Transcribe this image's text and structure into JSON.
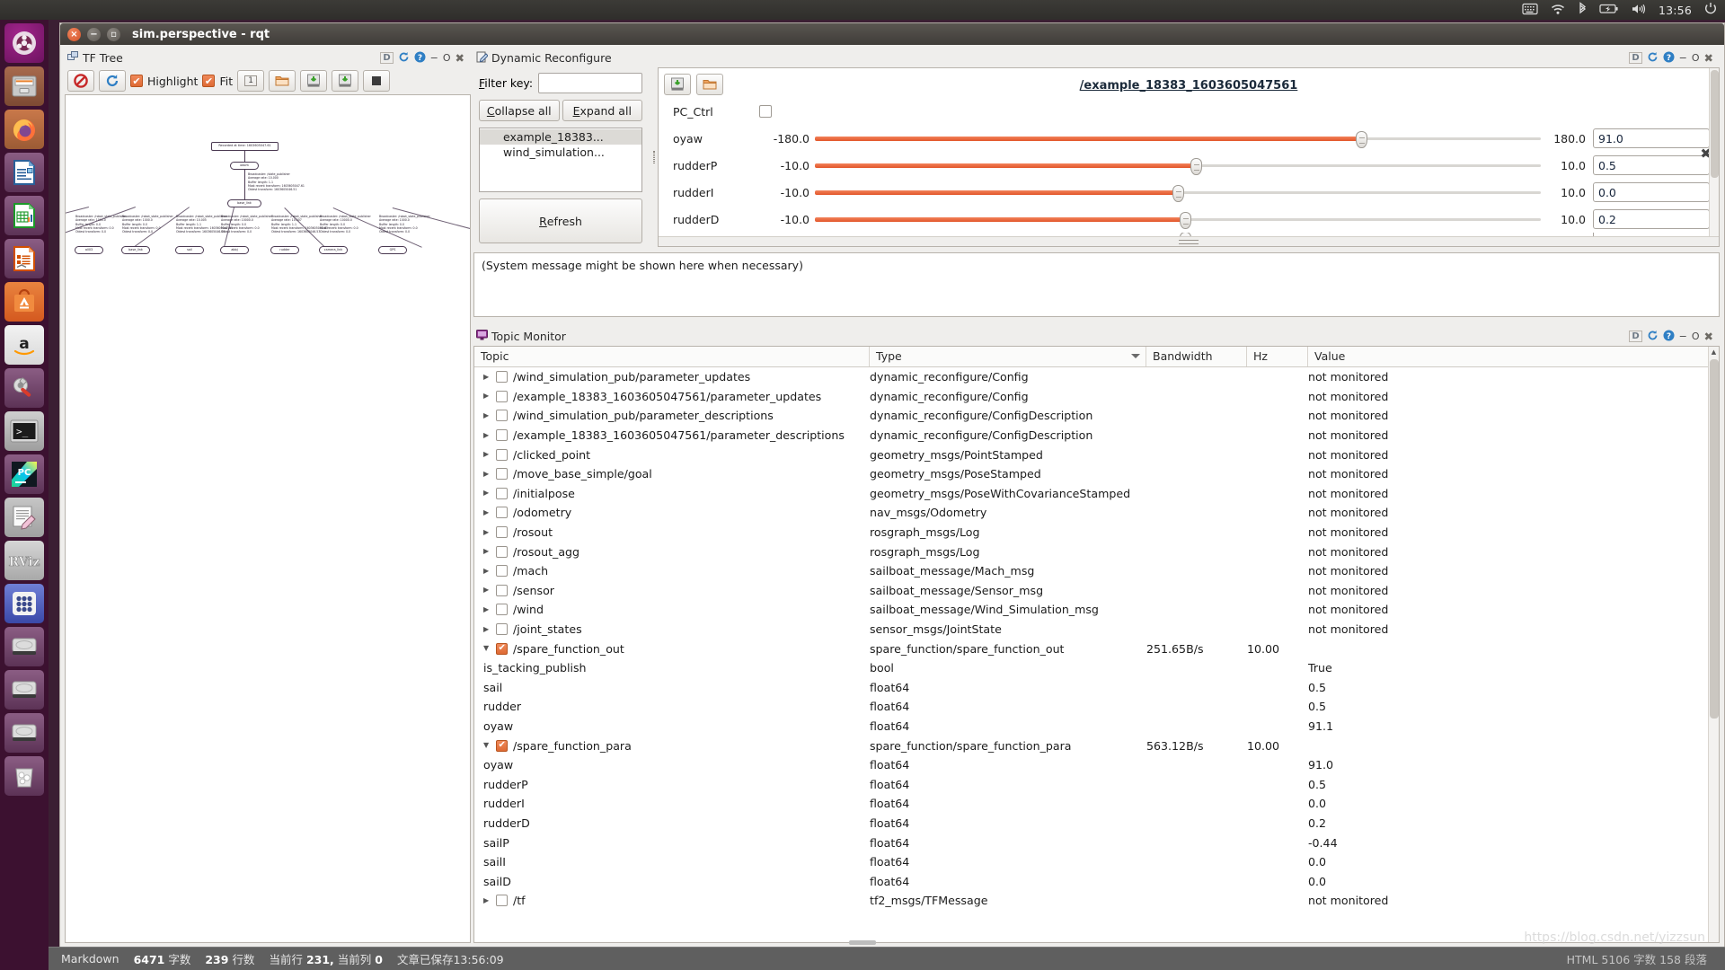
{
  "top_panel": {
    "icons": [
      "keyboard-icon",
      "wifi-icon",
      "bluetooth-icon",
      "battery-icon",
      "volume-icon",
      "power-icon"
    ],
    "clock": "13:56"
  },
  "launcher": {
    "items": [
      {
        "name": "ubuntu-dash-icon",
        "label": "Dash"
      },
      {
        "name": "files-icon",
        "label": "Files"
      },
      {
        "name": "firefox-icon",
        "label": "Firefox"
      },
      {
        "name": "libreoffice-writer-icon",
        "label": "LibreOffice Writer"
      },
      {
        "name": "libreoffice-calc-icon",
        "label": "LibreOffice Calc"
      },
      {
        "name": "libreoffice-impress-icon",
        "label": "LibreOffice Impress"
      },
      {
        "name": "ubuntu-software-icon",
        "label": "Ubuntu Software"
      },
      {
        "name": "amazon-icon",
        "label": "Amazon"
      },
      {
        "name": "system-settings-icon",
        "label": "System Settings"
      },
      {
        "name": "terminal-icon",
        "label": "Terminal"
      },
      {
        "name": "pycharm-icon",
        "label": "PyCharm"
      },
      {
        "name": "text-editor-icon",
        "label": "Text Editor"
      },
      {
        "name": "rviz-icon",
        "label": "RViz"
      },
      {
        "name": "show-applications-icon",
        "label": "Show Applications"
      },
      {
        "name": "disk-icon-1",
        "label": "Volume"
      },
      {
        "name": "disk-icon-2",
        "label": "Volume"
      },
      {
        "name": "disk-icon-3",
        "label": "Volume"
      },
      {
        "name": "trash-icon",
        "label": "Trash"
      }
    ]
  },
  "window": {
    "title": "sim.perspective - rqt"
  },
  "tf_tree": {
    "title": "TF Tree",
    "toolbar": {
      "stop_icon": "stop-refresh-icon",
      "refresh_icon": "refresh-icon",
      "highlight_label": "Highlight",
      "highlight_checked": true,
      "fit_label": "Fit",
      "fit_checked": true,
      "counter_label": "1",
      "open_icon": "open-folder-icon",
      "save_dot_icon": "save-dot-icon",
      "save_image_icon": "save-image-icon",
      "fullscreen_icon": "fullscreen-icon"
    },
    "dock_controls": [
      "D",
      "refresh-icon",
      "help-icon",
      "-",
      "O",
      "x"
    ],
    "graph": {
      "root_label": "Recorded at time: 1603605047.61",
      "nodes": [
        {
          "id": "odom",
          "label": "odom"
        },
        {
          "id": "base_link",
          "label": "base_link"
        },
        {
          "id": "all03",
          "label": "all03"
        },
        {
          "id": "base_link2",
          "label": "base_link"
        },
        {
          "id": "sail",
          "label": "sail"
        },
        {
          "id": "abbj",
          "label": "abbj"
        },
        {
          "id": "rudder",
          "label": "rudder"
        },
        {
          "id": "camera_link",
          "label": "camera_link"
        },
        {
          "id": "gps",
          "label": "GPS"
        }
      ],
      "edge_info": [
        "Broadcaster: /state_publisher\nAverage rate: 10.000\nBuffer length: 1.1\nMost recent transform: 1603605047.61\nOldest transform: 1603605046.51",
        "Broadcaster: /robot_state_publisher\nAverage rate: 1000.0\nBuffer length: 0.0\nMost recent transform: 0.0\nOldest transform: 0.0",
        "Broadcaster: /robot_state_publisher\nAverage rate: 1000.0\nBuffer length: 0.0\nMost recent transform: 0.0\nOldest transform: 0.0",
        "Broadcaster: /robot_state_publisher\nAverage rate: 10.005\nBuffer length: 1.1\nMost recent transform: 1603605047.63\nOldest transform: 1603605046.53",
        "Broadcaster: /robot_state_publisher\nAverage rate: 10000.0\nBuffer length: 0.0\nMost recent transform: 0.0\nOldest transform: 0.0",
        "Broadcaster: /robot_state_publisher\nAverage rate: 10.007\nBuffer length: 1.1\nMost recent transform: 1603605047.63\nOldest transform: 1603605046.53",
        "Broadcaster: /robot_state_publisher\nAverage rate: 10000.0\nBuffer length: 0.0\nMost recent transform: 0.0\nOldest transform: 0.0",
        "Broadcaster: /robot_state_publisher\nAverage rate: 1000.0\nBuffer length: 0.0\nMost recent transform: 0.0\nOldest transform: 0.0"
      ]
    }
  },
  "dynamic_reconfigure": {
    "title": "Dynamic Reconfigure",
    "filter_label": "Filter key:",
    "filter_value": "",
    "filter_placeholder": "",
    "collapse_all_label": "Collapse all",
    "expand_all_label": "Expand all",
    "refresh_label": "Refresh",
    "nodes": [
      {
        "label": "example_18383...",
        "selected": true
      },
      {
        "label": "wind_simulation...",
        "selected": false
      }
    ],
    "dock_controls": [
      "D",
      "refresh-icon",
      "help-icon",
      "-",
      "O",
      "x"
    ],
    "selected_node_title": "/example_18383_1603605047561",
    "toolbar": {
      "save_icon": "save-config-icon",
      "load_icon": "load-config-icon"
    },
    "close_label": "✖",
    "params": [
      {
        "name": "PC_Ctrl",
        "type": "bool",
        "checked": false
      },
      {
        "name": "oyaw",
        "type": "double",
        "min": "-180.0",
        "max": "180.0",
        "value": "91.0",
        "pct": 75.3
      },
      {
        "name": "rudderP",
        "type": "double",
        "min": "-10.0",
        "max": "10.0",
        "value": "0.5",
        "pct": 52.5
      },
      {
        "name": "rudderI",
        "type": "double",
        "min": "-10.0",
        "max": "10.0",
        "value": "0.0",
        "pct": 50.0
      },
      {
        "name": "rudderD",
        "type": "double",
        "min": "-10.0",
        "max": "10.0",
        "value": "0.2",
        "pct": 51.0
      }
    ]
  },
  "system_message": "(System message might be shown here when necessary)",
  "topic_monitor": {
    "title": "Topic Monitor",
    "dock_controls": [
      "D",
      "refresh-icon",
      "help-icon",
      "-",
      "O",
      "x"
    ],
    "columns": [
      "Topic",
      "Type",
      "Bandwidth",
      "Hz",
      "Value"
    ],
    "sorted_column": "Type",
    "rows": [
      {
        "indent": 0,
        "expander": "right",
        "checkbox": false,
        "topic": "/wind_simulation_pub/parameter_updates",
        "type": "dynamic_reconfigure/Config",
        "bandwidth": "",
        "hz": "",
        "value": "not monitored"
      },
      {
        "indent": 0,
        "expander": "right",
        "checkbox": false,
        "topic": "/example_18383_1603605047561/parameter_updates",
        "type": "dynamic_reconfigure/Config",
        "bandwidth": "",
        "hz": "",
        "value": "not monitored"
      },
      {
        "indent": 0,
        "expander": "right",
        "checkbox": false,
        "topic": "/wind_simulation_pub/parameter_descriptions",
        "type": "dynamic_reconfigure/ConfigDescription",
        "bandwidth": "",
        "hz": "",
        "value": "not monitored"
      },
      {
        "indent": 0,
        "expander": "right",
        "checkbox": false,
        "topic": "/example_18383_1603605047561/parameter_descriptions",
        "type": "dynamic_reconfigure/ConfigDescription",
        "bandwidth": "",
        "hz": "",
        "value": "not monitored"
      },
      {
        "indent": 0,
        "expander": "right",
        "checkbox": false,
        "topic": "/clicked_point",
        "type": "geometry_msgs/PointStamped",
        "bandwidth": "",
        "hz": "",
        "value": "not monitored"
      },
      {
        "indent": 0,
        "expander": "right",
        "checkbox": false,
        "topic": "/move_base_simple/goal",
        "type": "geometry_msgs/PoseStamped",
        "bandwidth": "",
        "hz": "",
        "value": "not monitored"
      },
      {
        "indent": 0,
        "expander": "right",
        "checkbox": false,
        "topic": "/initialpose",
        "type": "geometry_msgs/PoseWithCovarianceStamped",
        "bandwidth": "",
        "hz": "",
        "value": "not monitored"
      },
      {
        "indent": 0,
        "expander": "right",
        "checkbox": false,
        "topic": "/odometry",
        "type": "nav_msgs/Odometry",
        "bandwidth": "",
        "hz": "",
        "value": "not monitored"
      },
      {
        "indent": 0,
        "expander": "right",
        "checkbox": false,
        "topic": "/rosout",
        "type": "rosgraph_msgs/Log",
        "bandwidth": "",
        "hz": "",
        "value": "not monitored"
      },
      {
        "indent": 0,
        "expander": "right",
        "checkbox": false,
        "topic": "/rosout_agg",
        "type": "rosgraph_msgs/Log",
        "bandwidth": "",
        "hz": "",
        "value": "not monitored"
      },
      {
        "indent": 0,
        "expander": "right",
        "checkbox": false,
        "topic": "/mach",
        "type": "sailboat_message/Mach_msg",
        "bandwidth": "",
        "hz": "",
        "value": "not monitored"
      },
      {
        "indent": 0,
        "expander": "right",
        "checkbox": false,
        "topic": "/sensor",
        "type": "sailboat_message/Sensor_msg",
        "bandwidth": "",
        "hz": "",
        "value": "not monitored"
      },
      {
        "indent": 0,
        "expander": "right",
        "checkbox": false,
        "topic": "/wind",
        "type": "sailboat_message/Wind_Simulation_msg",
        "bandwidth": "",
        "hz": "",
        "value": "not monitored"
      },
      {
        "indent": 0,
        "expander": "right",
        "checkbox": false,
        "topic": "/joint_states",
        "type": "sensor_msgs/JointState",
        "bandwidth": "",
        "hz": "",
        "value": "not monitored"
      },
      {
        "indent": 0,
        "expander": "down",
        "checkbox": true,
        "topic": "/spare_function_out",
        "type": "spare_function/spare_function_out",
        "bandwidth": "251.65B/s",
        "hz": "10.00",
        "value": ""
      },
      {
        "indent": 1,
        "expander": "",
        "checkbox": null,
        "topic": "is_tacking_publish",
        "type": "bool",
        "bandwidth": "",
        "hz": "",
        "value": "True"
      },
      {
        "indent": 1,
        "expander": "",
        "checkbox": null,
        "topic": "sail",
        "type": "float64",
        "bandwidth": "",
        "hz": "",
        "value": "0.5"
      },
      {
        "indent": 1,
        "expander": "",
        "checkbox": null,
        "topic": "rudder",
        "type": "float64",
        "bandwidth": "",
        "hz": "",
        "value": "0.5"
      },
      {
        "indent": 1,
        "expander": "",
        "checkbox": null,
        "topic": "oyaw",
        "type": "float64",
        "bandwidth": "",
        "hz": "",
        "value": "91.1"
      },
      {
        "indent": 0,
        "expander": "down",
        "checkbox": true,
        "topic": "/spare_function_para",
        "type": "spare_function/spare_function_para",
        "bandwidth": "563.12B/s",
        "hz": "10.00",
        "value": ""
      },
      {
        "indent": 1,
        "expander": "",
        "checkbox": null,
        "topic": "oyaw",
        "type": "float64",
        "bandwidth": "",
        "hz": "",
        "value": "91.0"
      },
      {
        "indent": 1,
        "expander": "",
        "checkbox": null,
        "topic": "rudderP",
        "type": "float64",
        "bandwidth": "",
        "hz": "",
        "value": "0.5"
      },
      {
        "indent": 1,
        "expander": "",
        "checkbox": null,
        "topic": "rudderI",
        "type": "float64",
        "bandwidth": "",
        "hz": "",
        "value": "0.0"
      },
      {
        "indent": 1,
        "expander": "",
        "checkbox": null,
        "topic": "rudderD",
        "type": "float64",
        "bandwidth": "",
        "hz": "",
        "value": "0.2"
      },
      {
        "indent": 1,
        "expander": "",
        "checkbox": null,
        "topic": "sailP",
        "type": "float64",
        "bandwidth": "",
        "hz": "",
        "value": "-0.44"
      },
      {
        "indent": 1,
        "expander": "",
        "checkbox": null,
        "topic": "sailI",
        "type": "float64",
        "bandwidth": "",
        "hz": "",
        "value": "0.0"
      },
      {
        "indent": 1,
        "expander": "",
        "checkbox": null,
        "topic": "sailD",
        "type": "float64",
        "bandwidth": "",
        "hz": "",
        "value": "0.0"
      },
      {
        "indent": 0,
        "expander": "right",
        "checkbox": false,
        "topic": "/tf",
        "type": "tf2_msgs/TFMessage",
        "bandwidth": "",
        "hz": "",
        "value": "not monitored"
      }
    ]
  },
  "status_bar": {
    "format": "Markdown",
    "word_count_value": "6471",
    "word_count_label": "字数",
    "line_count_value": "239",
    "line_count_label": "行数",
    "cursor_label": "当前行",
    "cursor_line": "231,",
    "cursor_col_label": "当前列",
    "cursor_col": "0",
    "saved_label": "文章已保存13:56:09",
    "right_text": "HTML  5106 字数  158 段落"
  },
  "watermark": "https://blog.csdn.net/yizzsun",
  "colors": {
    "accent_orange": "#e2562a",
    "launcher_bg": "#3c1030",
    "panel_bg": "#efeeec",
    "titlebar": "#4a4640"
  }
}
